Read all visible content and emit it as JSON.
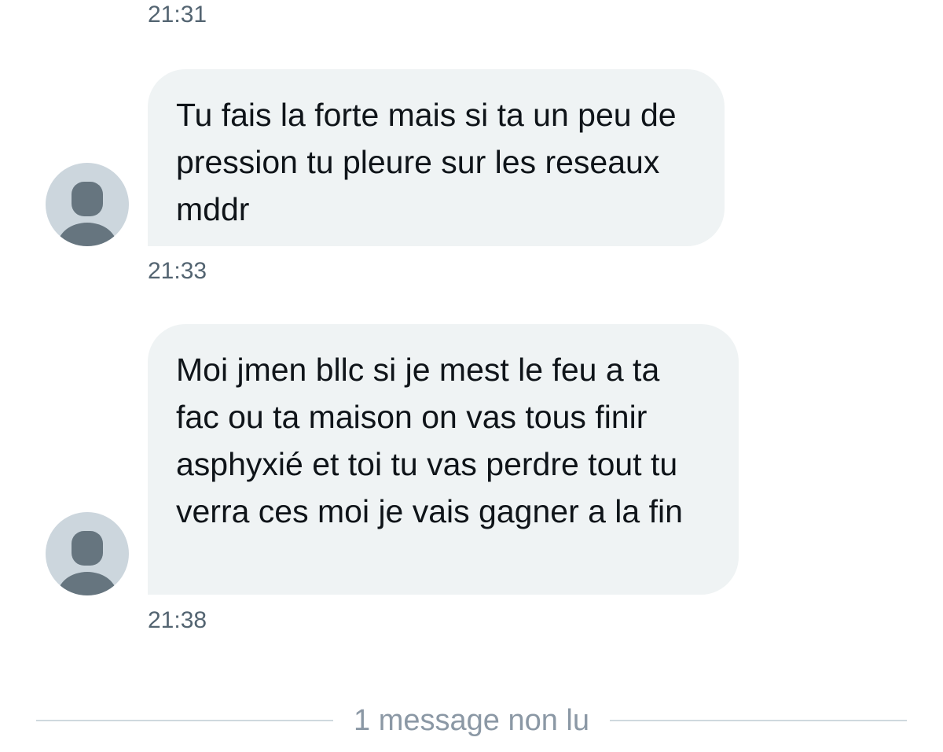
{
  "conversation": {
    "messages": [
      {
        "text": "Tu fais la forte mais si ta un peu de pression tu pleure sur les reseaux mddr",
        "time": "21:33"
      },
      {
        "text": "Moi jmen bllc si je mest le feu a ta fac ou ta maison on vas tous finir asphyxié et toi tu vas perdre tout tu verra ces moi je vais gagner a la fin",
        "time": "21:38"
      }
    ],
    "previous_time": "21:31",
    "unread_divider": "1 message non lu"
  },
  "colors": {
    "bubble_bg": "#eff3f4",
    "text": "#0f1419",
    "timestamp": "#536471",
    "avatar_bg": "#ccd6dd",
    "avatar_fg": "#66757f",
    "divider_text": "#8b98a5"
  },
  "icons": {
    "avatar": "default-profile-icon"
  }
}
